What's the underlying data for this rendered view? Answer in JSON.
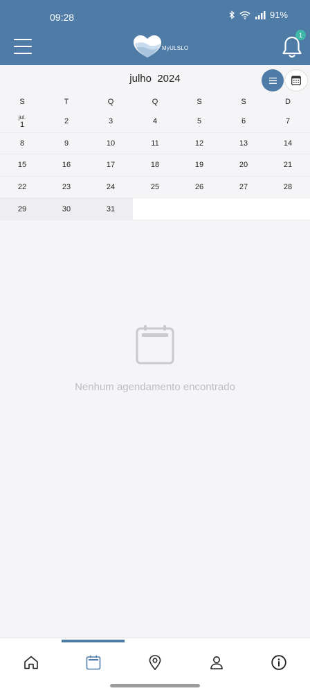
{
  "status_bar": {
    "time": "09:28",
    "battery": "91%"
  },
  "header": {
    "logo_text": "MyULSLO",
    "notification_count": "1"
  },
  "calendar": {
    "month": "julho",
    "year": "2024",
    "weekdays": [
      "S",
      "T",
      "Q",
      "Q",
      "S",
      "S",
      "D"
    ],
    "first_day_month_label": "jul.",
    "weeks": [
      [
        "1",
        "2",
        "3",
        "4",
        "5",
        "6",
        "7"
      ],
      [
        "8",
        "9",
        "10",
        "11",
        "12",
        "13",
        "14"
      ],
      [
        "15",
        "16",
        "17",
        "18",
        "19",
        "20",
        "21"
      ],
      [
        "22",
        "23",
        "24",
        "25",
        "26",
        "27",
        "28"
      ],
      [
        "29",
        "30",
        "31",
        "",
        "",
        "",
        ""
      ]
    ]
  },
  "empty_state": {
    "message": "Nenhum agendamento encontrado"
  },
  "colors": {
    "primary": "#4f7ba7",
    "badge": "#3fb8a8",
    "muted_text": "#bdbdc2",
    "background": "#f5f5f7"
  },
  "bottom_nav": {
    "items": [
      "home-icon",
      "calendar-icon",
      "location-pin-icon",
      "user-icon",
      "info-icon"
    ],
    "active": "calendar-icon"
  }
}
